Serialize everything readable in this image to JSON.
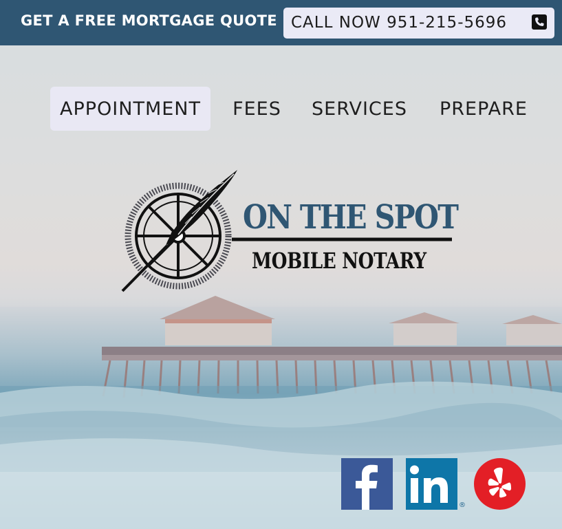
{
  "topbar": {
    "quote_label": "GET A FREE MORTGAGE QUOTE",
    "call_label": "CALL NOW 951-215-5696",
    "call_icon": "phone-icon",
    "background": "#2f5673"
  },
  "nav": {
    "items": [
      {
        "label": "APPOINTMENT",
        "active": true
      },
      {
        "label": "FEES",
        "active": false
      },
      {
        "label": "SERVICES",
        "active": false
      },
      {
        "label": "PREPARE",
        "active": false
      }
    ]
  },
  "logo": {
    "line1": "ON THE SPOT",
    "line2": "MOBILE NOTARY",
    "brand_color": "#2f5673"
  },
  "social": {
    "facebook": "facebook-icon",
    "linkedin": "linkedin-icon",
    "linkedin_mark": "®",
    "yelp": "yelp-icon"
  }
}
